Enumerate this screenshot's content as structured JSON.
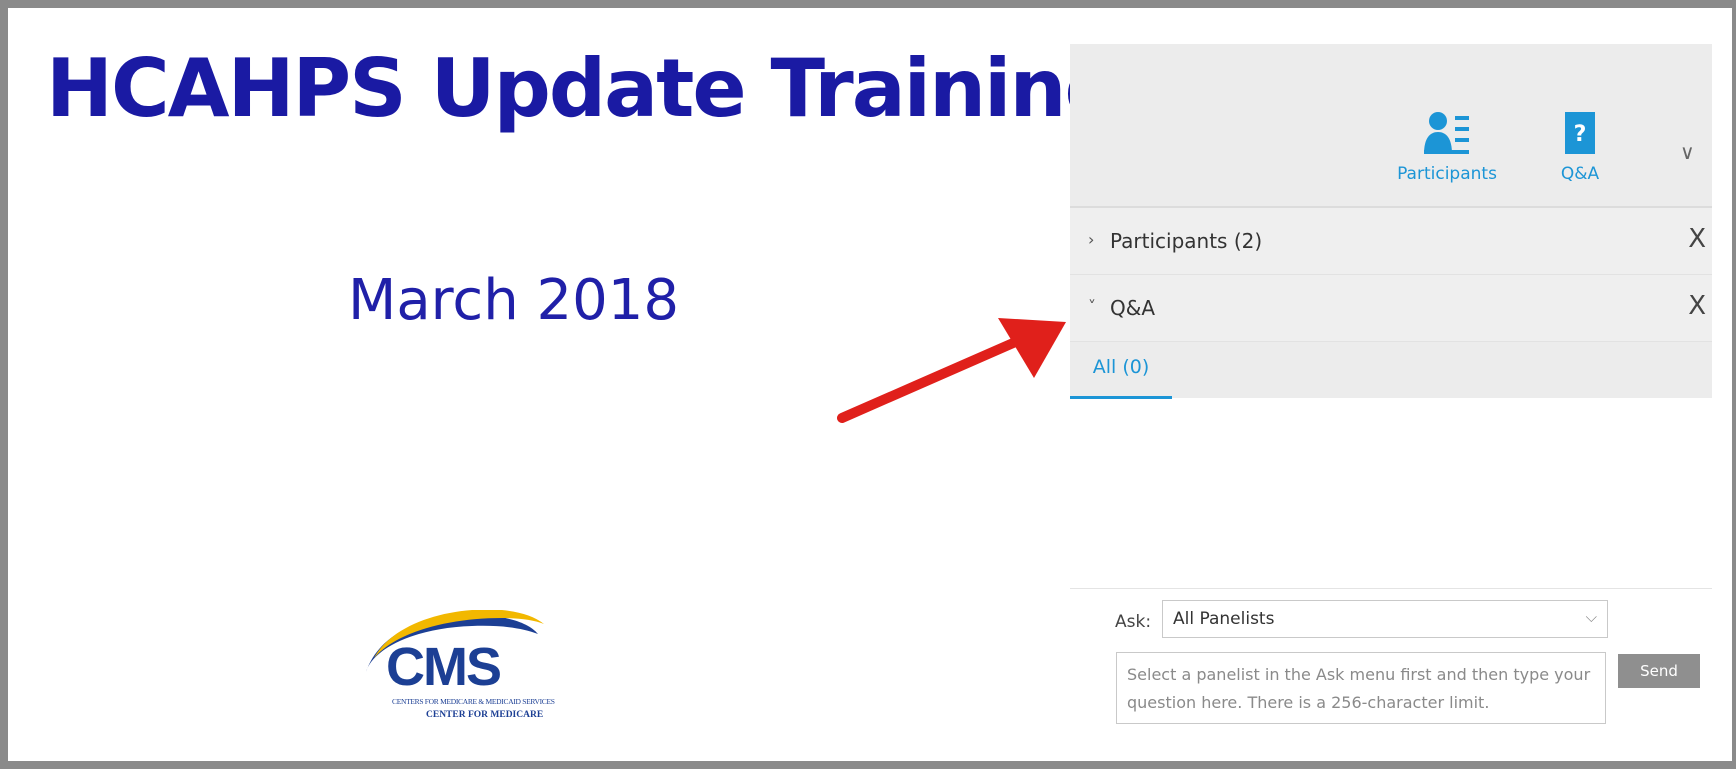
{
  "slide": {
    "title": "HCAHPS Update Training",
    "date": "March 2018",
    "logo": {
      "main": "CMS",
      "line1": "CENTERS FOR MEDICARE & MEDICAID SERVICES",
      "line2": "CENTER FOR MEDICARE"
    }
  },
  "panel": {
    "toolbar": {
      "participants_label": "Participants",
      "participants_icon": "participants-icon",
      "qa_label": "Q&A",
      "qa_icon": "question-mark-icon",
      "collapse_glyph": "∨"
    },
    "sections": [
      {
        "label": "Participants (2)",
        "expanded": false,
        "chevron": "›",
        "close": "X"
      },
      {
        "label": "Q&A",
        "expanded": true,
        "chevron": "˅",
        "close": "X"
      }
    ],
    "tabs": [
      {
        "label": "All (0)",
        "active": true
      }
    ],
    "ask": {
      "label": "Ask:",
      "selected": "All Panelists",
      "dropdown_glyph": "⌵"
    },
    "question_placeholder": "Select a panelist in the Ask menu first and then type your question here. There is a 256-character limit.",
    "send_label": "Send"
  },
  "colors": {
    "title": "#1a1aa3",
    "accent": "#1c95d6",
    "arrow": "#e0201b",
    "cms_blue": "#1c3f94",
    "cms_swoosh": "#f2b800"
  }
}
